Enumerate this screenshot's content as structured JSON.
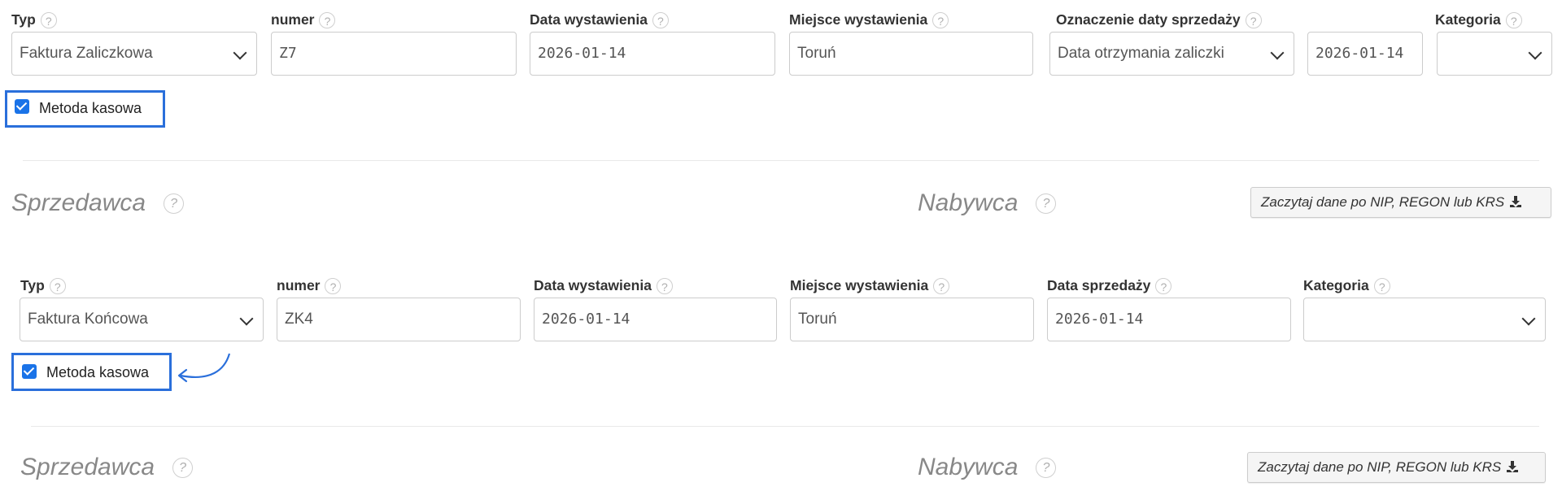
{
  "form1": {
    "typ_label": "Typ",
    "typ_value": "Faktura Zaliczkowa",
    "numer_label": "numer",
    "numer_value": "Z7",
    "data_wyst_label": "Data wystawienia",
    "data_wyst_value": "2026-01-14",
    "miejsce_label": "Miejsce wystawienia",
    "miejsce_value": "Toruń",
    "oznaczenie_label": "Oznaczenie daty sprzedaży",
    "oznaczenie_value": "Data otrzymania zaliczki",
    "oznaczenie_date_value": "2026-01-14",
    "kategoria_label": "Kategoria",
    "kategoria_value": "",
    "metoda_label": "Metoda kasowa",
    "metoda_checked": true,
    "sprzedawca": "Sprzedawca",
    "nabywca": "Nabywca",
    "fetch_button": "Zaczytaj dane po NIP, REGON lub KRS"
  },
  "form2": {
    "typ_label": "Typ",
    "typ_value": "Faktura Końcowa",
    "numer_label": "numer",
    "numer_value": "ZK4",
    "data_wyst_label": "Data wystawienia",
    "data_wyst_value": "2026-01-14",
    "miejsce_label": "Miejsce wystawienia",
    "miejsce_value": "Toruń",
    "data_sprzedazy_label": "Data sprzedaży",
    "data_sprzedazy_value": "2026-01-14",
    "kategoria_label": "Kategoria",
    "kategoria_value": "",
    "metoda_label": "Metoda kasowa",
    "metoda_checked": true,
    "sprzedawca": "Sprzedawca",
    "nabywca": "Nabywca",
    "fetch_button": "Zaczytaj dane po NIP, REGON lub KRS"
  },
  "help_glyph": "?",
  "colors": {
    "highlight_border": "#2a6fdb",
    "checkbox": "#1a73e8",
    "section_title": "#888888"
  }
}
